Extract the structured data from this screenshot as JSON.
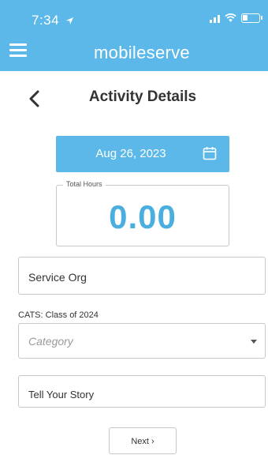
{
  "status_bar": {
    "time": "7:34",
    "icons": [
      "location-arrow-icon",
      "signal-icon",
      "wifi-icon",
      "battery-icon"
    ]
  },
  "nav": {
    "brand": "mobileserve",
    "menu_icon": "hamburger-menu-icon"
  },
  "header": {
    "title": "Activity Details",
    "back_icon": "chevron-left-icon"
  },
  "date": {
    "value": "Aug 26, 2023",
    "icon": "calendar-icon"
  },
  "hours": {
    "label": "Total Hours",
    "value": "0.00"
  },
  "form": {
    "service_org_placeholder": "Service Org",
    "cats_label": "CATS: Class of 2024",
    "category_placeholder": "Category",
    "story_placeholder": "Tell Your Story"
  },
  "footer": {
    "next_label": "Next ›"
  },
  "colors": {
    "brand_blue": "#5bb8e8",
    "hours_blue": "#4aaee0",
    "border_gray": "#c8c8c8",
    "text_dark": "#333333"
  }
}
